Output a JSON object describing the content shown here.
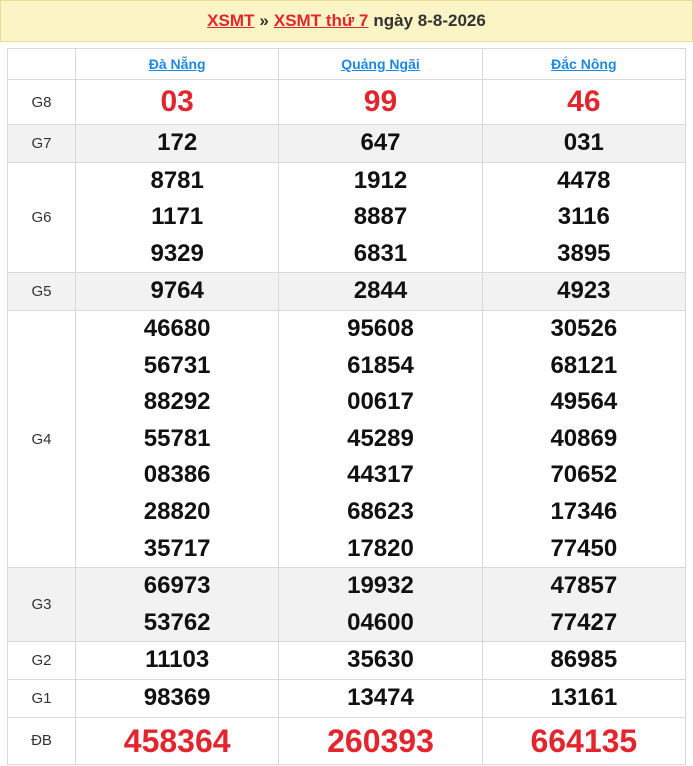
{
  "header": {
    "link1": "XSMT",
    "separator": "»",
    "link2": "XSMT thứ 7",
    "date_text": "ngày 8-8-2026"
  },
  "columns": [
    "Đà Nẵng",
    "Quảng Ngãi",
    "Đắc Nông"
  ],
  "prizes": {
    "g8": {
      "label": "G8",
      "values": [
        [
          "03"
        ],
        [
          "99"
        ],
        [
          "46"
        ]
      ]
    },
    "g7": {
      "label": "G7",
      "values": [
        [
          "172"
        ],
        [
          "647"
        ],
        [
          "031"
        ]
      ]
    },
    "g6": {
      "label": "G6",
      "values": [
        [
          "8781",
          "1171",
          "9329"
        ],
        [
          "1912",
          "8887",
          "6831"
        ],
        [
          "4478",
          "3116",
          "3895"
        ]
      ]
    },
    "g5": {
      "label": "G5",
      "values": [
        [
          "9764"
        ],
        [
          "2844"
        ],
        [
          "4923"
        ]
      ]
    },
    "g4": {
      "label": "G4",
      "values": [
        [
          "46680",
          "56731",
          "88292",
          "55781",
          "08386",
          "28820",
          "35717"
        ],
        [
          "95608",
          "61854",
          "00617",
          "45289",
          "44317",
          "68623",
          "17820"
        ],
        [
          "30526",
          "68121",
          "49564",
          "40869",
          "70652",
          "17346",
          "77450"
        ]
      ]
    },
    "g3": {
      "label": "G3",
      "values": [
        [
          "66973",
          "53762"
        ],
        [
          "19932",
          "04600"
        ],
        [
          "47857",
          "77427"
        ]
      ]
    },
    "g2": {
      "label": "G2",
      "values": [
        [
          "11103"
        ],
        [
          "35630"
        ],
        [
          "86985"
        ]
      ]
    },
    "g1": {
      "label": "G1",
      "values": [
        [
          "98369"
        ],
        [
          "13474"
        ],
        [
          "13161"
        ]
      ]
    },
    "db": {
      "label": "ĐB",
      "values": [
        [
          "458364"
        ],
        [
          "260393"
        ],
        [
          "664135"
        ]
      ]
    }
  },
  "colors": {
    "accent_red": "#e3262d",
    "link_blue": "#1e88e5",
    "header_bg": "#fbf4c4",
    "row_shade": "#f2f2f2"
  }
}
